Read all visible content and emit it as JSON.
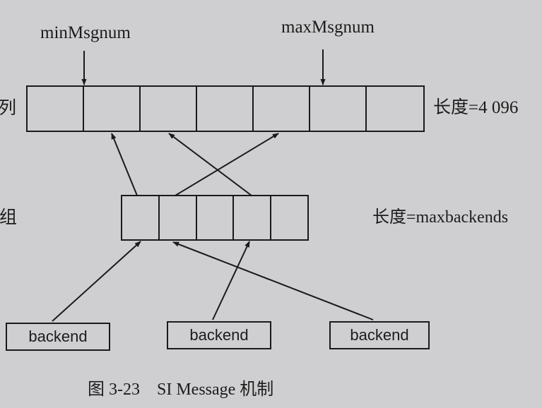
{
  "labels": {
    "top_left_fragment": "列",
    "mid_left_fragment": "组",
    "min_pointer": "minMsgnum",
    "max_pointer": "maxMsgnum",
    "queue_length": "长度=4 096",
    "array_length": "长度=maxbackends"
  },
  "backends": [
    "backend",
    "backend",
    "backend"
  ],
  "caption": "图 3-23    SI Message 机制",
  "colors": {
    "background": "#cfcfd1",
    "line": "#1a1a1a"
  }
}
